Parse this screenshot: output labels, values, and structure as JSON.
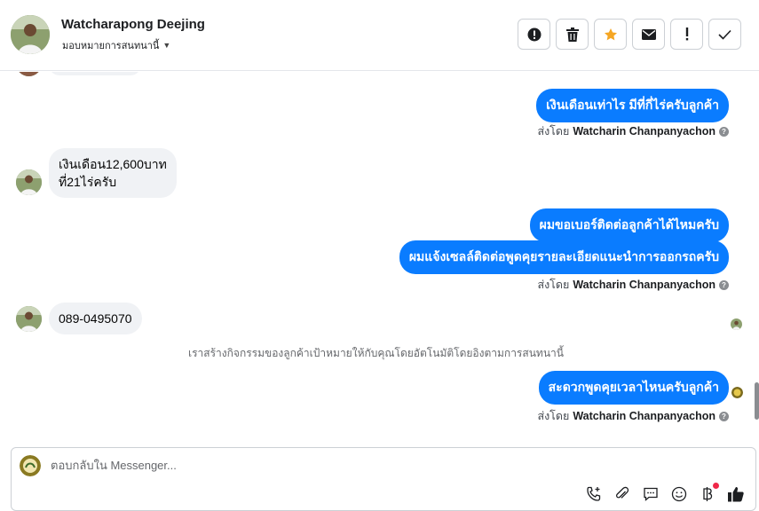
{
  "header": {
    "name": "Watcharapong Deejing",
    "subtitle": "มอบหมายการสนทนานี้"
  },
  "actions": [
    {
      "name": "report-spam-button",
      "icon": "alert-circle-icon"
    },
    {
      "name": "delete-button",
      "icon": "trash-icon"
    },
    {
      "name": "star-button",
      "icon": "star-icon"
    },
    {
      "name": "mark-unread-button",
      "icon": "envelope-icon"
    },
    {
      "name": "follow-up-button",
      "icon": "exclamation-icon"
    },
    {
      "name": "mark-done-button",
      "icon": "check-icon"
    }
  ],
  "accent": "#0a7cff",
  "star_color": "#f5a623",
  "messages": {
    "out1": "เงินเดือนเท่าไร มีที่กี่ไร่ครับลูกค้า",
    "sent_prefix": "ส่งโดย",
    "sender": "Watcharin Chanpanyachon",
    "in1_line1": "เงินเดือน12,600บาท",
    "in1_line2": "ที่21ไร่ครับ",
    "out2": "ผมขอเบอร์ติดต่อลูกค้าได้ไหมครับ",
    "out3": "ผมแจ้งเซลล์ติดต่อพูดคุยรายละเอียดแนะนำการออกรถครับ",
    "in2": "089-0495070",
    "system": "เราสร้างกิจกรรมของลูกค้าเป้าหมายให้กับคุณโดยอัตโนมัติโดยอิงตามการสนทนานี้",
    "out4": "สะดวกพูดคุยเวลาไหนครับลูกค้า"
  },
  "composer": {
    "placeholder": "ตอบกลับใน Messenger..."
  }
}
